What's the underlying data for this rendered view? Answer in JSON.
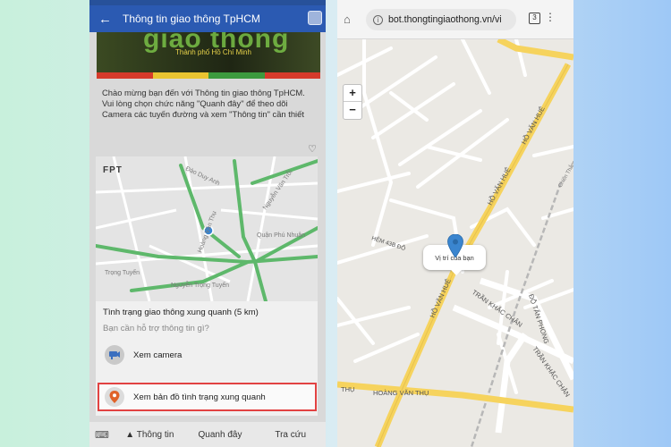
{
  "left_screen": {
    "header": {
      "back_icon": "arrow-left-icon",
      "title": "Thông tin giao thông TpHCM"
    },
    "banner": {
      "title": "giao thông",
      "subtitle": "Thành phố Hồ Chí Minh"
    },
    "message": {
      "line1": "Chào mừng bạn đến với Thông tin giao thông TpHCM.",
      "line2": "Vui lòng chọn chức năng \"Quanh đây\" để theo dõi Camera các tuyến đường và xem \"Thông tin\" cần thiết"
    },
    "card": {
      "logo": "FPT",
      "map_labels": [
        "Đào Duy Anh",
        "Hoàng Văn Thụ",
        "Nguyễn Văn Trỗi",
        "Quận Phú Nhuận",
        "Nguyễn Trọng Tuyển",
        "Trọng Tuyển"
      ],
      "title": "Tình trạng giao thông xung quanh (5 km)",
      "subtitle": "Bạn cần hỗ trợ thông tin gì?",
      "options": [
        {
          "icon": "camera-icon",
          "label": "Xem camera"
        },
        {
          "icon": "map-pin-icon",
          "label": "Xem bản đồ tình trạng xung quanh"
        }
      ]
    },
    "bottom_bar": {
      "keyboard_icon": "keyboard-icon",
      "tabs": [
        "▲ Thông tin",
        "Quanh đây",
        "Tra cứu"
      ]
    }
  },
  "right_screen": {
    "browser": {
      "home_icon": "home-icon",
      "url": "bot.thongtingiaothong.vn/vi",
      "tab_count": "3"
    },
    "zoom": {
      "in": "+",
      "out": "−"
    },
    "popup": {
      "text": "Vị trí của bạn"
    },
    "street_labels": {
      "hoang_van_thu": "HOÀNG VĂN THỤ",
      "ho_van_hue_1": "HỒ VĂN HUÊ",
      "ho_van_hue_2": "HỒ VĂN HUÊ",
      "ho_van_hue_3": "HỒ VĂN HUÊ",
      "hem": "HẺM 43B ĐỖ",
      "tran_khac_chan_1": "TRẦN KHẮC CHÂN",
      "tran_khac_chan_2": "TRẦN KHẮC CHÂN",
      "do_tan_phong": "ĐỖ TẤN PHONG",
      "chien_thang": "Chiến Thắng",
      "thu_left": "THỤ"
    }
  },
  "colors": {
    "messenger_blue": "#2b5ab2",
    "major_road": "#f6d35d",
    "marker_blue": "#3a85cf",
    "highlight_border": "#e24242"
  }
}
